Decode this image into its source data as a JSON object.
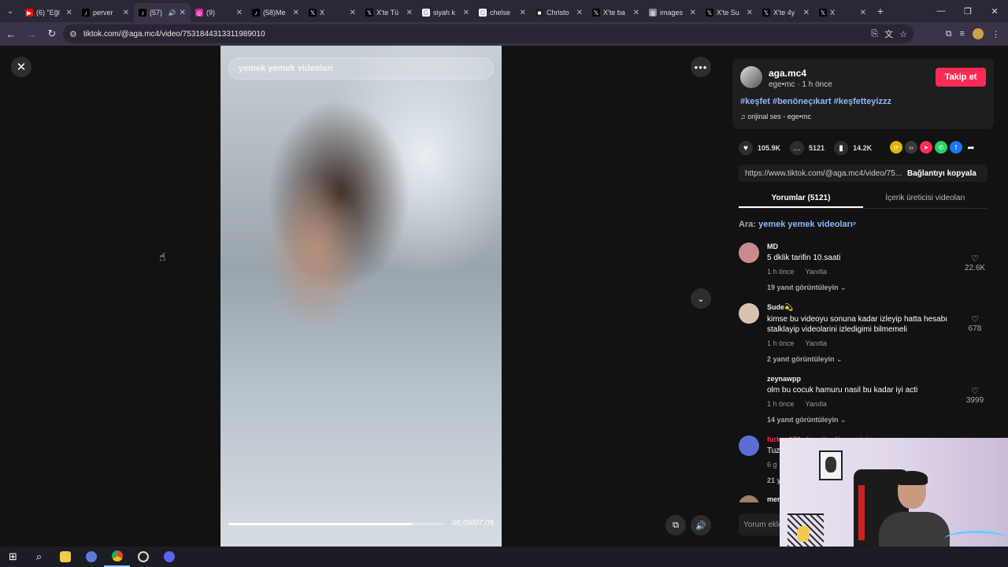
{
  "browser": {
    "tabs": [
      {
        "title": "(6) \"Eğl",
        "fav": "▶",
        "fav_color": "#ff0000"
      },
      {
        "title": "perver",
        "fav": "♪",
        "fav_color": "#000000"
      },
      {
        "title": "(57)",
        "fav": "♪",
        "fav_color": "#000000",
        "audio": "🔊"
      },
      {
        "title": "(9)",
        "fav": "◎",
        "fav_color": "#d6249f"
      },
      {
        "title": "(58)Me",
        "fav": "♪",
        "fav_color": "#000000"
      },
      {
        "title": "X",
        "fav": "𝕏",
        "fav_color": "#000000"
      },
      {
        "title": "X'te Tü",
        "fav": "𝕏",
        "fav_color": "#000000"
      },
      {
        "title": "siyah k",
        "fav": "G",
        "fav_color": "#ffffff"
      },
      {
        "title": "chelse",
        "fav": "G",
        "fav_color": "#ffffff"
      },
      {
        "title": "Christo",
        "fav": "■",
        "fav_color": "#222222"
      },
      {
        "title": "X'te ba",
        "fav": "𝕏",
        "fav_color": "#000000"
      },
      {
        "title": "images",
        "fav": "◍",
        "fav_color": "#888888"
      },
      {
        "title": "X'te Su",
        "fav": "𝕏",
        "fav_color": "#000000"
      },
      {
        "title": "X'te 4y",
        "fav": "𝕏",
        "fav_color": "#000000"
      },
      {
        "title": "X",
        "fav": "𝕏",
        "fav_color": "#000000"
      }
    ],
    "url": "tiktok.com/@aga.mc4/video/7531844313311989010"
  },
  "video": {
    "search_query": "yemek yemek videoları",
    "time": "06:09/07:09",
    "progress_fraction": 0.855
  },
  "author": {
    "name": "aga.mc4",
    "sub": "ege•mc · 1 h önce",
    "follow_label": "Takip et",
    "hashtags": "#keşfet #benöneçıkart #keşfetteyizzz",
    "sound": "orijinal ses - ege•mc"
  },
  "stats": {
    "likes": "105.9K",
    "comments": "5121",
    "saves": "14.2K"
  },
  "link": {
    "url": "https://www.tiktok.com/@aga.mc4/video/75...",
    "copy_label": "Bağlantıyı kopyala"
  },
  "tabs": {
    "comments_label": "Yorumlar (5121)",
    "creator_label": "İçerik üreticisi videoları"
  },
  "search_line": {
    "prefix": "Ara:",
    "term": "yemek yemek videoları"
  },
  "comments": [
    {
      "user": "MD",
      "text": "5 dklik tarifin 10.saati",
      "time": "1 h önce",
      "reply": "Yanıtla",
      "replies": "19 yanıt görüntüleyin ⌄",
      "likes": "22.6K",
      "avatar_color": "#c98c8c"
    },
    {
      "user": "Sude💫",
      "text": "kimse bu videoyu sonuna kadar izleyip hatta hesabı stalklayip videolarini izledigimi bilmemeli",
      "time": "1 h önce",
      "reply": "Yanıtla",
      "replies": "2 yanıt görüntüleyin ⌄",
      "likes": "678",
      "avatar_color": "#d9c2b0"
    },
    {
      "user": "zeynawpp",
      "text": "olm bu cocuk hamuru nasil bu kadar iyi acti",
      "time": "1 h önce",
      "reply": "Yanıtla",
      "replies": "14 yanıt görüntüleyin ⌄",
      "likes": "3999",
      "avatar_color": "#111111"
    },
    {
      "user": "furkan178 : hergün döcer misin",
      "text": "Tuz",
      "time": "6 g",
      "reply": "",
      "replies": "21 y",
      "likes": "",
      "avatar_color": "#5a6fd6"
    },
    {
      "user": "mer",
      "text": "",
      "time": "",
      "reply": "",
      "replies": "",
      "likes": "",
      "avatar_color": "#a08060"
    }
  ],
  "comment_input": {
    "placeholder": "Yorum ekle"
  }
}
